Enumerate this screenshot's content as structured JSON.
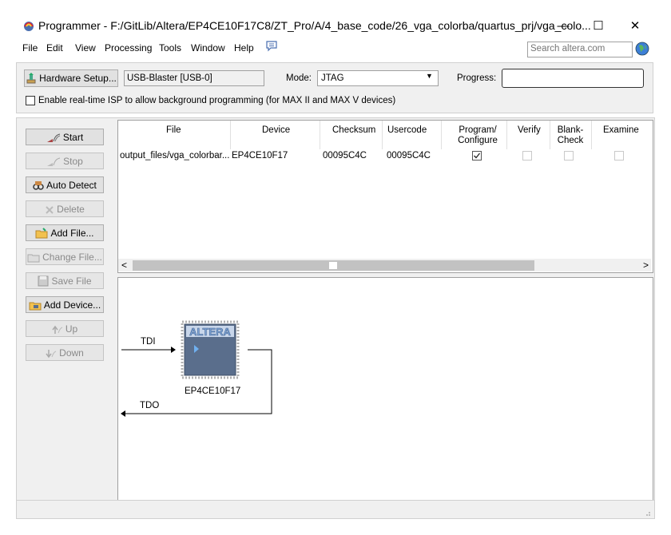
{
  "window": {
    "title": "Programmer - F:/GitLib/Altera/EP4CE10F17C8/ZT_Pro/A/4_base_code/26_vga_colorba/quartus_prj/vga_colo...",
    "minimize_glyph": "—",
    "maximize_glyph": "☐",
    "close_glyph": "✕"
  },
  "menu": [
    "File",
    "Edit",
    "View",
    "Processing",
    "Tools",
    "Window",
    "Help"
  ],
  "search": {
    "placeholder": "Search altera.com"
  },
  "toolbar": {
    "hardware_setup_label": "Hardware Setup...",
    "hardware_value": "USB-Blaster [USB-0]",
    "mode_label": "Mode:",
    "mode_value": "JTAG",
    "progress_label": "Progress:",
    "isp_label": "Enable real-time ISP to allow background programming (for MAX II and MAX V devices)",
    "isp_checked": false
  },
  "side_buttons": [
    {
      "label": "Start",
      "icon": "start-icon",
      "enabled": true
    },
    {
      "label": "Stop",
      "icon": "stop-icon",
      "enabled": false
    },
    {
      "label": "Auto Detect",
      "icon": "auto-detect-icon",
      "enabled": true
    },
    {
      "label": "Delete",
      "icon": "delete-icon",
      "enabled": false
    },
    {
      "label": "Add File...",
      "icon": "add-file-icon",
      "enabled": true
    },
    {
      "label": "Change File...",
      "icon": "change-file-icon",
      "enabled": false
    },
    {
      "label": "Save File",
      "icon": "save-file-icon",
      "enabled": false
    },
    {
      "label": "Add Device...",
      "icon": "add-device-icon",
      "enabled": true
    },
    {
      "label": "Up",
      "icon": "up-icon",
      "enabled": false
    },
    {
      "label": "Down",
      "icon": "down-icon",
      "enabled": false
    }
  ],
  "table": {
    "headers": {
      "file": "File",
      "device": "Device",
      "checksum": "Checksum",
      "usercode": "Usercode",
      "program_1": "Program/",
      "program_2": "Configure",
      "verify": "Verify",
      "blank_1": "Blank-",
      "blank_2": "Check",
      "examine": "Examine"
    },
    "rows": [
      {
        "file": "output_files/vga_colorbar...",
        "device": "EP4CE10F17",
        "checksum": "00095C4C",
        "usercode": "00095C4C",
        "program": true,
        "verify": false,
        "blank_check": false,
        "examine": false
      }
    ],
    "scroll_left": "<",
    "scroll_right": ">"
  },
  "chain": {
    "tdi_label": "TDI",
    "tdo_label": "TDO",
    "device_label": "EP4CE10F17",
    "chip_logo": "ALTERA"
  },
  "colors": {
    "chip_body": "#5a6e8c",
    "chip_logo": "#7ea4d6",
    "panel_bg": "#f0f0f0"
  }
}
